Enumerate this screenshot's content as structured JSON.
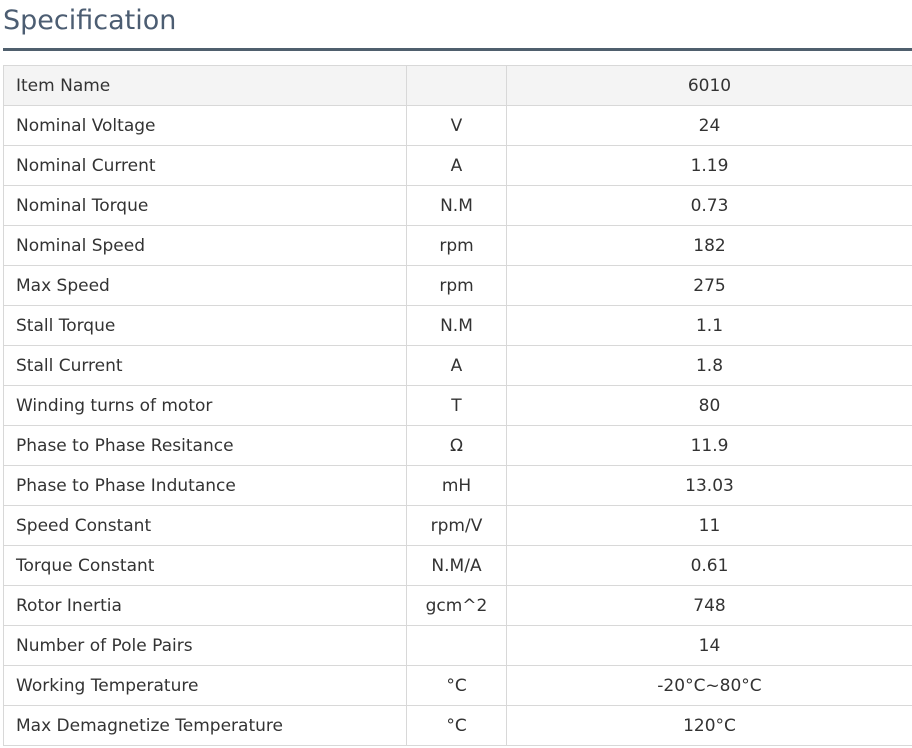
{
  "heading": "Specification",
  "table": {
    "header": {
      "name": "Item Name",
      "unit": "",
      "value": "6010"
    },
    "rows": [
      {
        "name": "Nominal Voltage",
        "unit": "V",
        "value": "24"
      },
      {
        "name": "Nominal Current",
        "unit": "A",
        "value": "1.19"
      },
      {
        "name": "Nominal Torque",
        "unit": "N.M",
        "value": "0.73"
      },
      {
        "name": "Nominal Speed",
        "unit": "rpm",
        "value": "182"
      },
      {
        "name": "Max Speed",
        "unit": "rpm",
        "value": "275"
      },
      {
        "name": "Stall Torque",
        "unit": "N.M",
        "value": "1.1"
      },
      {
        "name": "Stall Current",
        "unit": "A",
        "value": "1.8"
      },
      {
        "name": "Winding turns of motor",
        "unit": "T",
        "value": "80"
      },
      {
        "name": "Phase to Phase Resitance",
        "unit": "Ω",
        "value": "11.9"
      },
      {
        "name": "Phase to Phase Indutance",
        "unit": "mH",
        "value": "13.03"
      },
      {
        "name": "Speed Constant",
        "unit": "rpm/V",
        "value": "11"
      },
      {
        "name": "Torque Constant",
        "unit": "N.M/A",
        "value": "0.61"
      },
      {
        "name": "Rotor Inertia",
        "unit": "gcm^2",
        "value": "748"
      },
      {
        "name": "Number of Pole Pairs",
        "unit": "",
        "value": "14"
      },
      {
        "name": "Working Temperature",
        "unit": "°C",
        "value": "-20°C~80°C"
      },
      {
        "name": "Max Demagnetize Temperature",
        "unit": "°C",
        "value": "120°C"
      }
    ]
  }
}
